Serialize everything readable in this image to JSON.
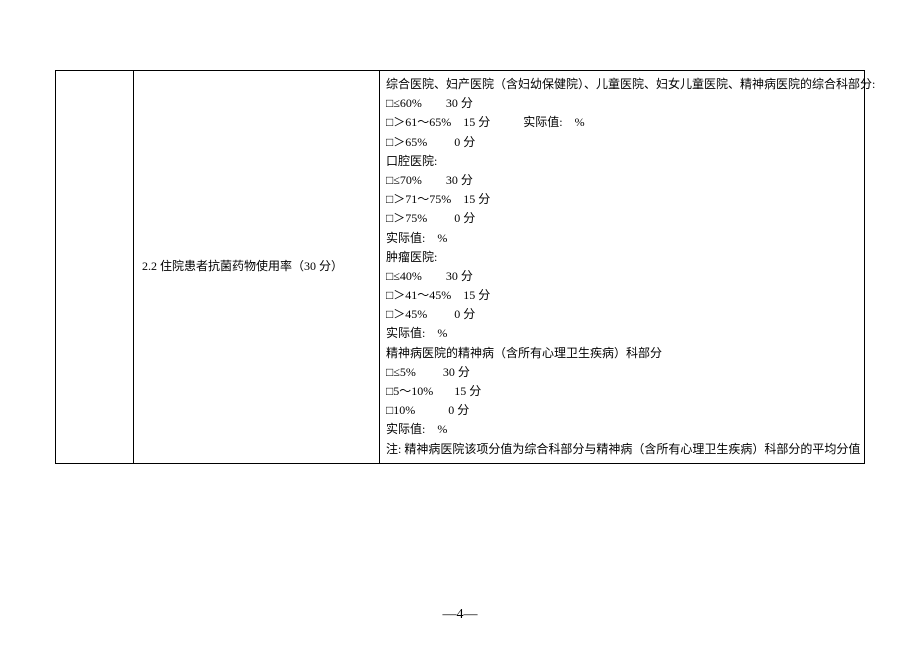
{
  "row": {
    "col2": "2.2 住院患者抗菌药物使用率（30 分）",
    "details": [
      "综合医院、妇产医院（含妇幼保健院）、儿童医院、妇女儿童医院、精神病医院的综合科部分:",
      "□≤60%        30 分",
      "□＞61～65%    15 分           实际值:    %",
      "□＞65%         0 分",
      "口腔医院:",
      "□≤70%        30 分",
      "□＞71～75%    15 分",
      "□＞75%         0 分",
      "实际值:    %",
      "肿瘤医院:",
      "□≤40%        30 分",
      "□＞41～45%    15 分",
      "□＞45%         0 分",
      "实际值:    %",
      "精神病医院的精神病（含所有心理卫生疾病）科部分",
      "□≤5%         30 分",
      "□5～10%       15 分",
      "□10%           0 分",
      "实际值:    %",
      "注: 精神病医院该项分值为综合科部分与精神病（含所有心理卫生疾病）科部分的平均分值"
    ]
  },
  "page_number": "—4—"
}
